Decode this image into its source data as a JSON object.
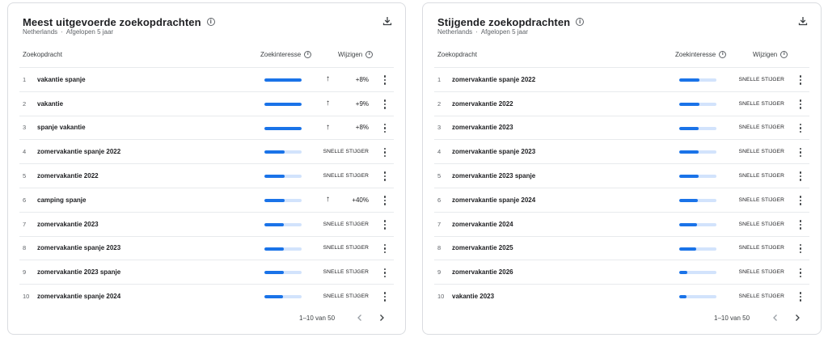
{
  "panels": [
    {
      "title": "Meest uitgevoerde zoekopdrachten",
      "region": "Netherlands",
      "period": "Afgelopen 5 jaar",
      "col_query": "Zoekopdracht",
      "col_interest": "Zoekinteresse",
      "col_change": "Wijzigen",
      "pagination": "1–10 van 50",
      "rows": [
        {
          "rank": "1",
          "query": "vakantie spanje",
          "interest": 1.0,
          "change": "+8%",
          "arrow": "↑"
        },
        {
          "rank": "2",
          "query": "vakantie",
          "interest": 1.0,
          "change": "+9%",
          "arrow": "↑"
        },
        {
          "rank": "3",
          "query": "spanje vakantie",
          "interest": 1.0,
          "change": "+8%",
          "arrow": "↑"
        },
        {
          "rank": "4",
          "query": "zomervakantie spanje 2022",
          "interest": 0.55,
          "change": "SNELLE STIJGER",
          "arrow": ""
        },
        {
          "rank": "5",
          "query": "zomervakantie 2022",
          "interest": 0.55,
          "change": "SNELLE STIJGER",
          "arrow": ""
        },
        {
          "rank": "6",
          "query": "camping spanje",
          "interest": 0.55,
          "change": "+40%",
          "arrow": "↑"
        },
        {
          "rank": "7",
          "query": "zomervakantie 2023",
          "interest": 0.52,
          "change": "SNELLE STIJGER",
          "arrow": ""
        },
        {
          "rank": "8",
          "query": "zomervakantie spanje 2023",
          "interest": 0.52,
          "change": "SNELLE STIJGER",
          "arrow": ""
        },
        {
          "rank": "9",
          "query": "zomervakantie 2023 spanje",
          "interest": 0.52,
          "change": "SNELLE STIJGER",
          "arrow": ""
        },
        {
          "rank": "10",
          "query": "zomervakantie spanje 2024",
          "interest": 0.5,
          "change": "SNELLE STIJGER",
          "arrow": ""
        }
      ]
    },
    {
      "title": "Stijgende zoekopdrachten",
      "region": "Netherlands",
      "period": "Afgelopen 5 jaar",
      "col_query": "Zoekopdracht",
      "col_interest": "Zoekinteresse",
      "col_change": "Wijzigen",
      "pagination": "1–10 van 50",
      "rows": [
        {
          "rank": "1",
          "query": "zomervakantie spanje 2022",
          "interest": 0.55,
          "change": "SNELLE STIJGER",
          "arrow": ""
        },
        {
          "rank": "2",
          "query": "zomervakantie 2022",
          "interest": 0.55,
          "change": "SNELLE STIJGER",
          "arrow": ""
        },
        {
          "rank": "3",
          "query": "zomervakantie 2023",
          "interest": 0.52,
          "change": "SNELLE STIJGER",
          "arrow": ""
        },
        {
          "rank": "4",
          "query": "zomervakantie spanje 2023",
          "interest": 0.52,
          "change": "SNELLE STIJGER",
          "arrow": ""
        },
        {
          "rank": "5",
          "query": "zomervakantie 2023 spanje",
          "interest": 0.52,
          "change": "SNELLE STIJGER",
          "arrow": ""
        },
        {
          "rank": "6",
          "query": "zomervakantie spanje 2024",
          "interest": 0.5,
          "change": "SNELLE STIJGER",
          "arrow": ""
        },
        {
          "rank": "7",
          "query": "zomervakantie 2024",
          "interest": 0.48,
          "change": "SNELLE STIJGER",
          "arrow": ""
        },
        {
          "rank": "8",
          "query": "zomervakantie 2025",
          "interest": 0.46,
          "change": "SNELLE STIJGER",
          "arrow": ""
        },
        {
          "rank": "9",
          "query": "zomervakantie 2026",
          "interest": 0.22,
          "change": "SNELLE STIJGER",
          "arrow": ""
        },
        {
          "rank": "10",
          "query": "vakantie 2023",
          "interest": 0.2,
          "change": "SNELLE STIJGER",
          "arrow": ""
        }
      ]
    }
  ],
  "icons": {
    "download": "download-icon",
    "info": "info-icon",
    "more": "more-vert-icon",
    "prev": "chevron-left-icon",
    "next": "chevron-right-icon"
  },
  "colors": {
    "bar_fill": "#1a73e8",
    "bar_track": "#d2e3fc",
    "border": "#dadce0"
  }
}
